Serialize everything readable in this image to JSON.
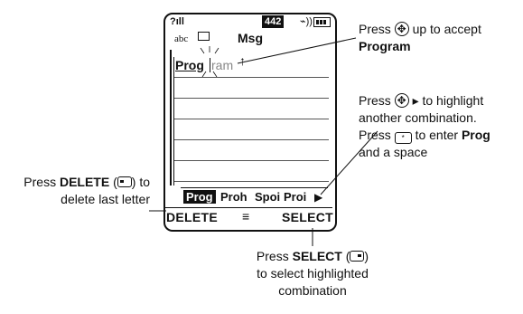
{
  "phone": {
    "status": {
      "signal": "?ıll",
      "counter": "442",
      "battery": "⌁))"
    },
    "header": {
      "mode": "abc",
      "title": "Msg"
    },
    "entry": {
      "typed": "Prog",
      "completion": "ram"
    },
    "candidates": [
      "Prog",
      "Proh",
      "Spoi",
      "Proi"
    ],
    "softkeys": {
      "left": "DELETE",
      "center": "≡",
      "right": "SELECT"
    }
  },
  "callouts": {
    "accept": {
      "line1_pre": "Press ",
      "line1_post": " up to accept",
      "bold": "Program"
    },
    "highlight": {
      "line1_pre": "Press ",
      "line1_post": " ▸ to highlight",
      "line2": "another combination.",
      "line3_pre": "Press ",
      "line3_mid": " to enter ",
      "bold": "Prog",
      "line4": "and a space"
    },
    "delete": {
      "pre": "Press ",
      "bold": "DELETE",
      "post": ") to",
      "line2": "delete last letter"
    },
    "select": {
      "pre": "Press ",
      "bold": "SELECT",
      "post": ")",
      "line2": "to select highlighted",
      "line3": "combination"
    }
  }
}
